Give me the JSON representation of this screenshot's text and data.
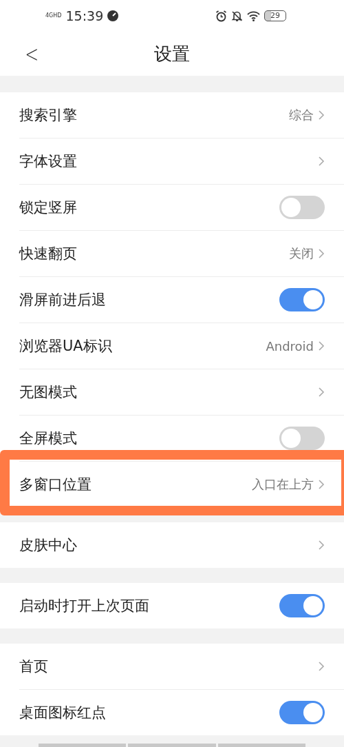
{
  "status_bar": {
    "network": "4GHD",
    "time": "15:39",
    "battery": "29"
  },
  "header": {
    "back": "<",
    "title": "设置"
  },
  "sections": [
    {
      "rows": [
        {
          "kind": "link",
          "label": "搜索引擎",
          "value": "综合",
          "highlighted": false
        },
        {
          "kind": "link",
          "label": "字体设置",
          "highlighted": false
        },
        {
          "kind": "toggle",
          "label": "锁定竖屏",
          "on": false,
          "highlighted": false
        },
        {
          "kind": "link",
          "label": "快速翻页",
          "value": "关闭",
          "highlighted": false
        },
        {
          "kind": "toggle",
          "label": "滑屏前进后退",
          "on": true,
          "highlighted": false
        },
        {
          "kind": "link",
          "label": "浏览器UA标识",
          "value": "Android",
          "highlighted": false
        },
        {
          "kind": "link",
          "label": "无图模式",
          "highlighted": false
        },
        {
          "kind": "toggle",
          "label": "全屏模式",
          "on": false,
          "highlighted": false
        },
        {
          "kind": "link",
          "label": "多窗口位置",
          "value": "入口在上方",
          "highlighted": true
        }
      ]
    },
    {
      "rows": [
        {
          "kind": "link",
          "label": "皮肤中心",
          "highlighted": false
        }
      ]
    },
    {
      "rows": [
        {
          "kind": "toggle",
          "label": "启动时打开上次页面",
          "on": true,
          "highlighted": false
        }
      ]
    },
    {
      "rows": [
        {
          "kind": "link",
          "label": "首页",
          "highlighted": false
        },
        {
          "kind": "toggle",
          "label": "桌面图标红点",
          "on": true,
          "highlighted": false
        }
      ]
    }
  ]
}
